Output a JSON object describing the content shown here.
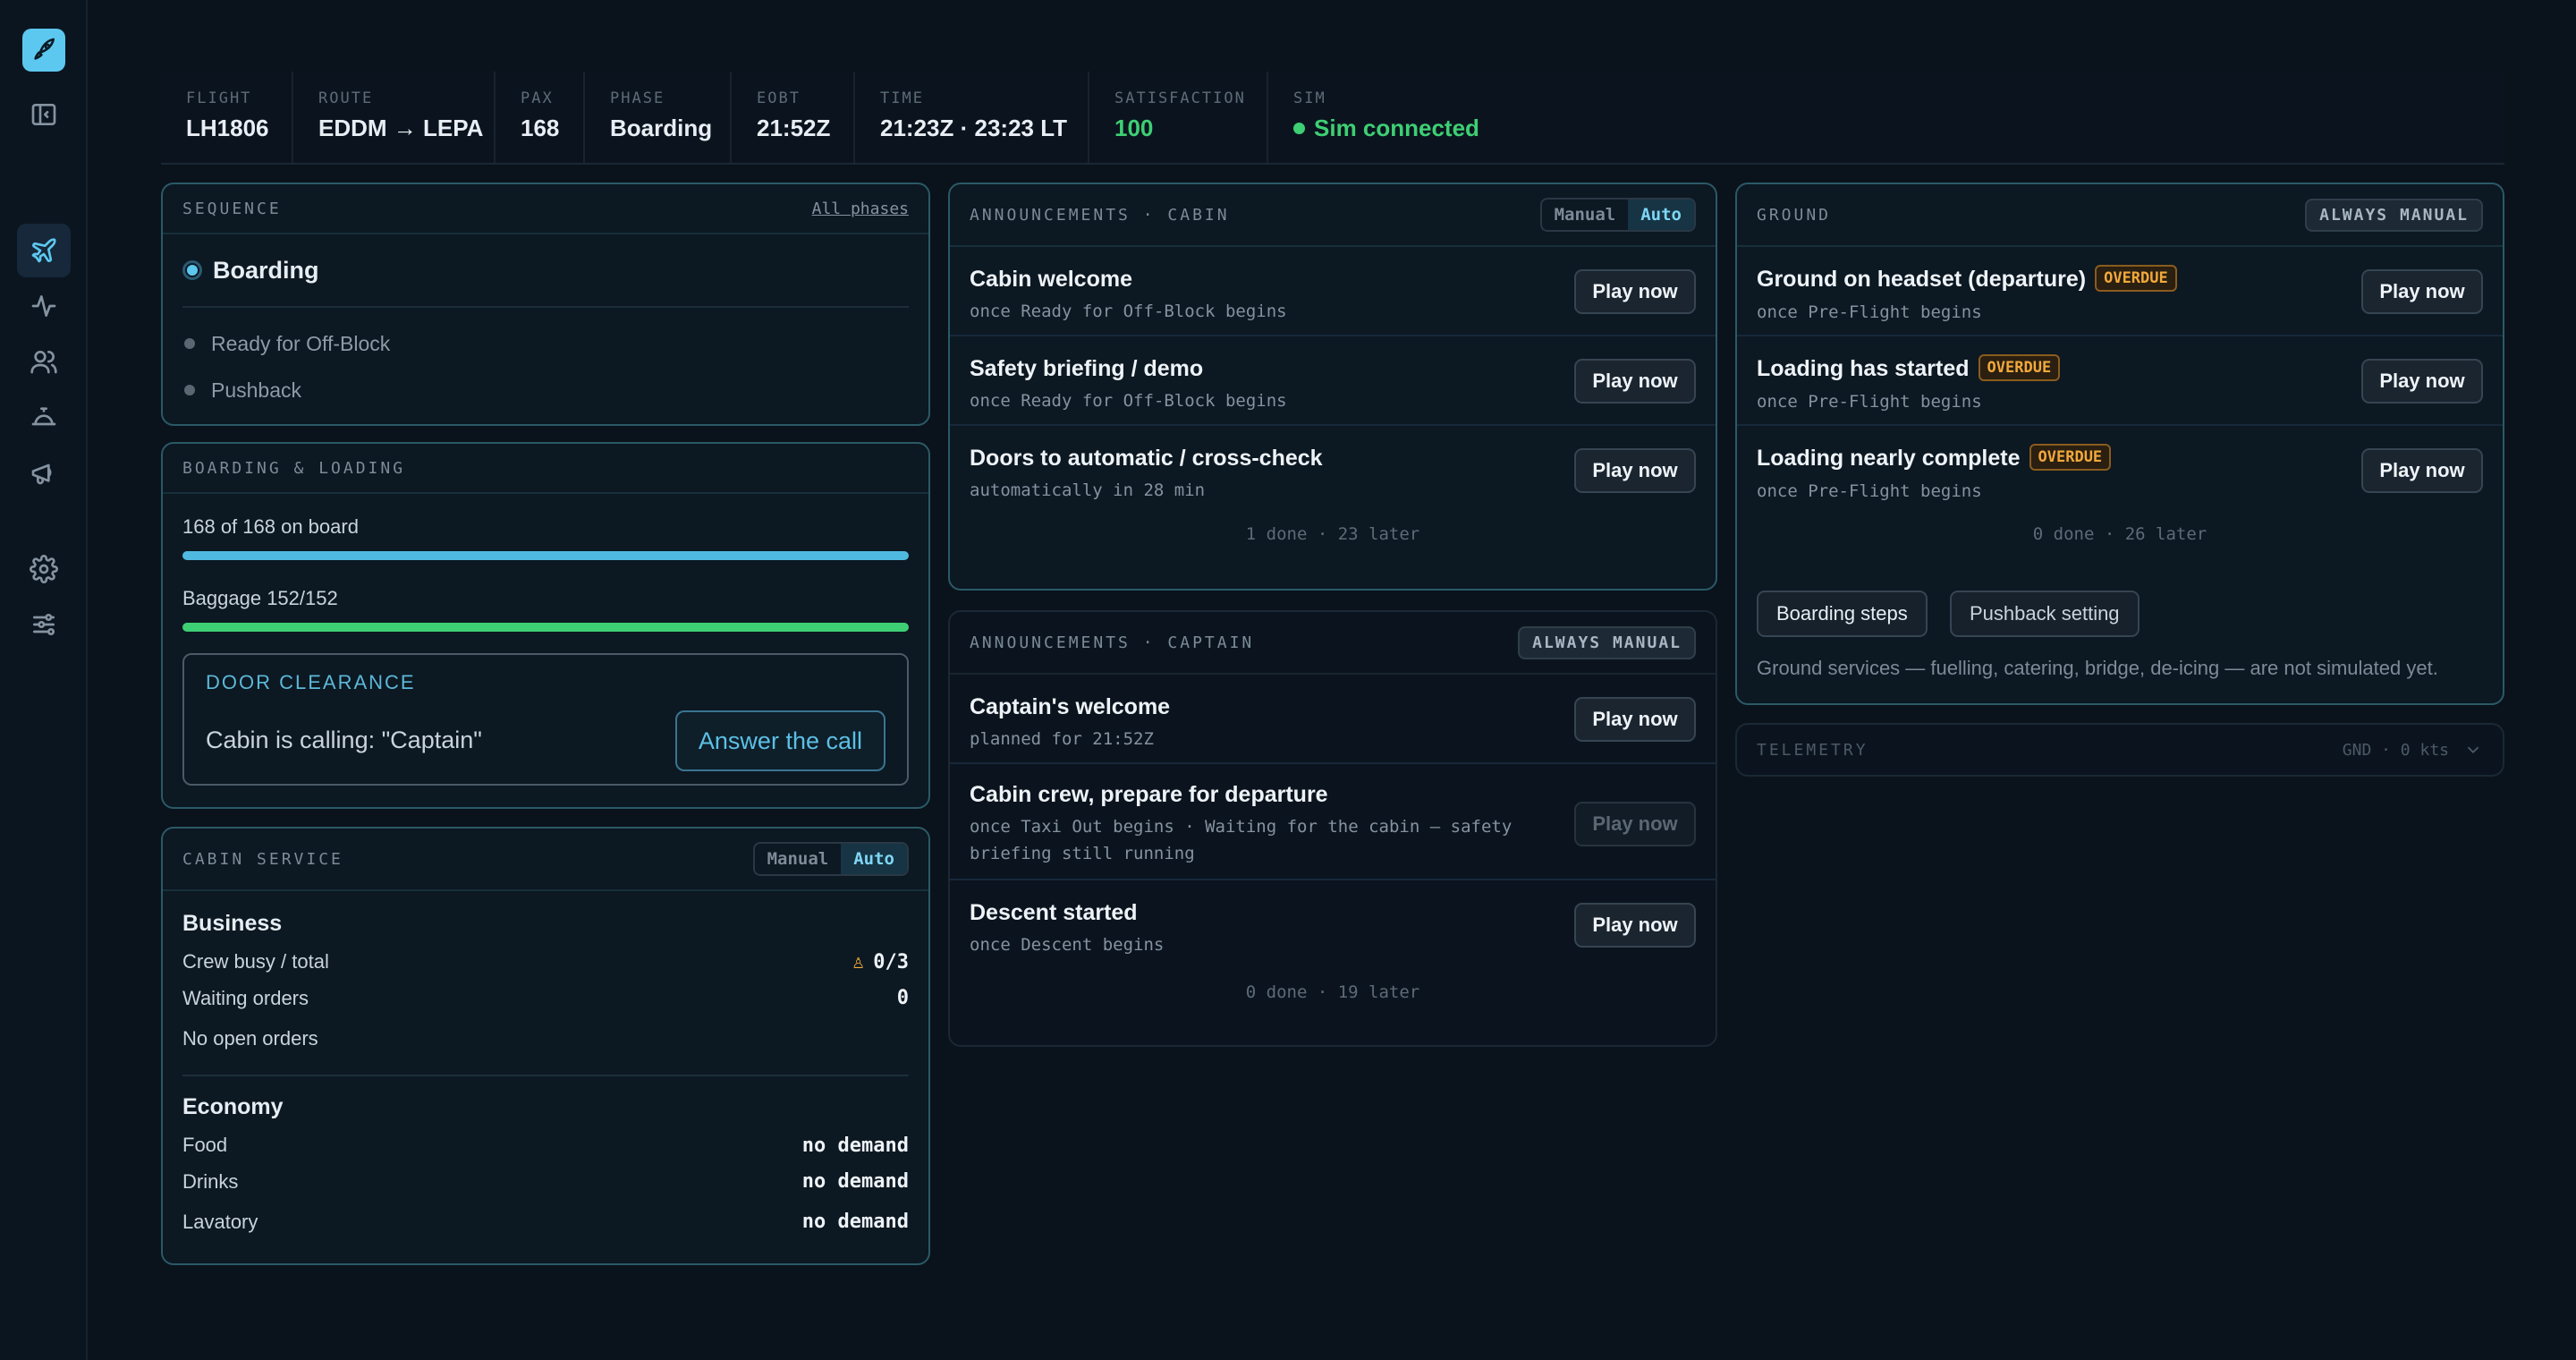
{
  "header": [
    {
      "label": "FLIGHT",
      "value": "LH1806"
    },
    {
      "label": "ROUTE",
      "value": "EDDM → LEPA"
    },
    {
      "label": "PAX",
      "value": "168"
    },
    {
      "label": "PHASE",
      "value": "Boarding"
    },
    {
      "label": "EOBT",
      "value": "21:52Z"
    },
    {
      "label": "TIME",
      "value": "21:23Z · 23:23 LT"
    },
    {
      "label": "SATISFACTION",
      "value": "100"
    },
    {
      "label": "SIM",
      "value": "Sim connected"
    }
  ],
  "sequence": {
    "title": "SEQUENCE",
    "link": "All phases",
    "current": "Boarding",
    "next": [
      "Ready for Off-Block",
      "Pushback"
    ]
  },
  "boarding": {
    "title": "BOARDING & LOADING",
    "pax_label": "168 of 168 on board",
    "pax_progress": 1.0,
    "baggage_label": "Baggage 152/152",
    "baggage_progress": 1.0,
    "door_title": "DOOR CLEARANCE",
    "door_message": "Cabin is calling: \"Captain\"",
    "answer_label": "Answer the call",
    "colors": {
      "pax": "#4fb9e0",
      "baggage": "#3ecf74"
    }
  },
  "cabin_service": {
    "title": "CABIN SERVICE",
    "toggle": {
      "manual": "Manual",
      "auto": "Auto",
      "selected": "auto"
    },
    "business": {
      "title": "Business",
      "crew_label": "Crew busy / total",
      "crew_value": "0/3",
      "waiting_label": "Waiting orders",
      "waiting_value": "0",
      "no_orders": "No open orders"
    },
    "economy": {
      "title": "Economy",
      "rows": [
        {
          "label": "Food",
          "value": "no demand"
        },
        {
          "label": "Drinks",
          "value": "no demand"
        },
        {
          "label": "Lavatory",
          "value": "no demand"
        }
      ]
    }
  },
  "ann_cabin": {
    "title": "ANNOUNCEMENTS · CABIN",
    "toggle": {
      "manual": "Manual",
      "auto": "Auto",
      "selected": "auto"
    },
    "items": [
      {
        "title": "Cabin welcome",
        "sub": "once Ready for Off-Block begins",
        "button": "Play now"
      },
      {
        "title": "Safety briefing / demo",
        "sub": "once Ready for Off-Block begins",
        "button": "Play now"
      },
      {
        "title": "Doors to automatic / cross-check",
        "sub": "automatically in 28 min",
        "button": "Play now"
      }
    ],
    "footer": "1 done · 23 later"
  },
  "ann_captain": {
    "title": "ANNOUNCEMENTS · CAPTAIN",
    "badge": "ALWAYS MANUAL",
    "items": [
      {
        "title": "Captain's welcome",
        "sub": "planned for 21:52Z",
        "button": "Play now"
      },
      {
        "title": "Cabin crew, prepare for departure",
        "sub1": "once Taxi Out begins · Waiting for the cabin — safety",
        "sub2": "briefing still running",
        "button": "Play now"
      },
      {
        "title": "Descent started",
        "sub": "once Descent begins",
        "button": "Play now"
      }
    ],
    "footer": "0 done · 19 later"
  },
  "ground": {
    "title": "GROUND",
    "badge": "ALWAYS MANUAL",
    "overdue_label": "OVERDUE",
    "items": [
      {
        "title": "Ground on headset (departure)",
        "sub": "once Pre-Flight begins",
        "button": "Play now"
      },
      {
        "title": "Loading has started",
        "sub": "once Pre-Flight begins",
        "button": "Play now"
      },
      {
        "title": "Loading nearly complete",
        "sub": "once Pre-Flight begins",
        "button": "Play now"
      }
    ],
    "footer": "0 done · 26 later",
    "chips": [
      "Boarding steps",
      "Pushback setting"
    ],
    "note": "Ground services — fuelling, catering, bridge, de-icing — are not simulated yet."
  },
  "telemetry": {
    "title": "TELEMETRY",
    "summary": "GND · 0 kts"
  }
}
